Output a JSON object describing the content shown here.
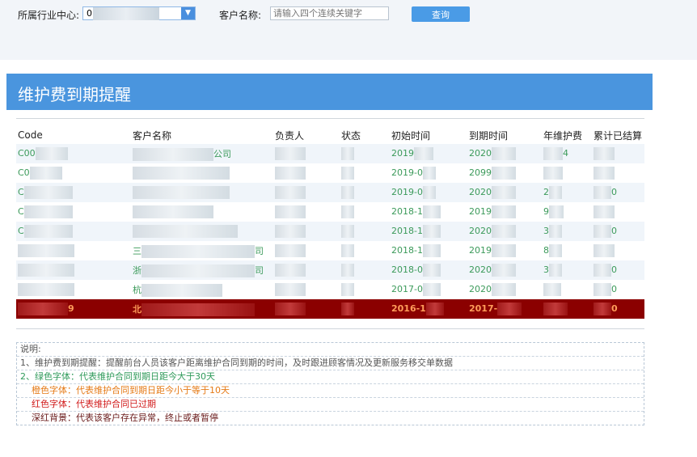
{
  "filter": {
    "industry_label": "所属行业中心:",
    "industry_value": "0",
    "customer_label": "客户名称:",
    "customer_placeholder": "请输入四个连续关键字",
    "query_button": "查询"
  },
  "panel": {
    "title": "维护费到期提醒"
  },
  "table": {
    "columns": [
      "Code",
      "客户名称",
      "负责人",
      "状态",
      "初始时间",
      "到期时间",
      "年维护费",
      "累计已结算"
    ],
    "rows": [
      {
        "status": "green",
        "cells": [
          "C00",
          "公司",
          "",
          "",
          "2019",
          "2020",
          "4",
          ""
        ]
      },
      {
        "status": "green",
        "cells": [
          "C0",
          "",
          "",
          "",
          "2019-0",
          "2099",
          "",
          ""
        ]
      },
      {
        "status": "green",
        "cells": [
          "C",
          "",
          "",
          "",
          "2019-0",
          "2020",
          "2",
          "0"
        ]
      },
      {
        "status": "green",
        "cells": [
          "C",
          "",
          "",
          "",
          "2018-1",
          "2019",
          "9",
          ""
        ]
      },
      {
        "status": "green",
        "cells": [
          "C",
          "",
          "",
          "",
          "2018-1",
          "2020",
          "3",
          "0"
        ]
      },
      {
        "status": "green",
        "cells": [
          "",
          "三",
          "司",
          "",
          "2018-1",
          "2019",
          "8",
          ""
        ]
      },
      {
        "status": "green",
        "cells": [
          "",
          "浙",
          "司",
          "",
          "2018-0",
          "2020",
          "3",
          "0"
        ]
      },
      {
        "status": "green",
        "cells": [
          "",
          "杭",
          "",
          "",
          "2017-0",
          "2020",
          "",
          "0"
        ]
      },
      {
        "status": "danger",
        "cells": [
          "9",
          "北",
          "",
          "",
          "2016-1",
          "2017-",
          "",
          "0"
        ]
      }
    ]
  },
  "notes": {
    "title": "说明:",
    "lines": [
      "1、维护费到期提醒：提醒前台人员该客户距离维护合同到期的时间，及时跟进顾客情况及更新服务移交单数据",
      "2、绿色字体：代表维护合同到期日距今大于30天",
      "橙色字体：代表维护合同到期日距今小于等于10天",
      "红色字体：代表维护合同已过期",
      "深红背景：代表该客户存在异常，终止或者暂停"
    ]
  },
  "colors": {
    "banner": "#4a95de",
    "green_text": "#3b9a5a",
    "orange_text": "#e57a16",
    "red_text": "#d11a1a",
    "danger_bg": "#8b0000"
  }
}
